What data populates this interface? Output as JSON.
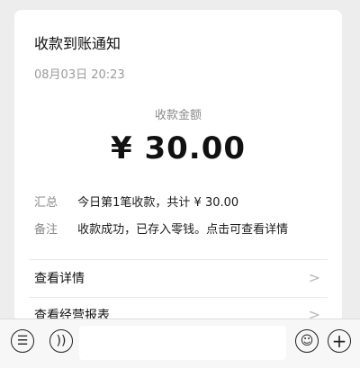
{
  "card": {
    "title": "收款到账通知",
    "time": "08月03日 20:23",
    "amount_label": "收款金额",
    "amount": "¥ 30.00",
    "rows": [
      {
        "key": "汇总",
        "value": "今日第1笔收款，共计 ¥ 30.00"
      },
      {
        "key": "备注",
        "value": "收款成功，已存入零钱。点击可查看详情"
      }
    ],
    "links": [
      {
        "label": "查看详情"
      },
      {
        "label": "查看经营报表"
      }
    ]
  },
  "bottom_bar": {
    "icons": [
      "menu-icon",
      "voice-icon",
      "emoji-icon",
      "plus-icon"
    ]
  }
}
